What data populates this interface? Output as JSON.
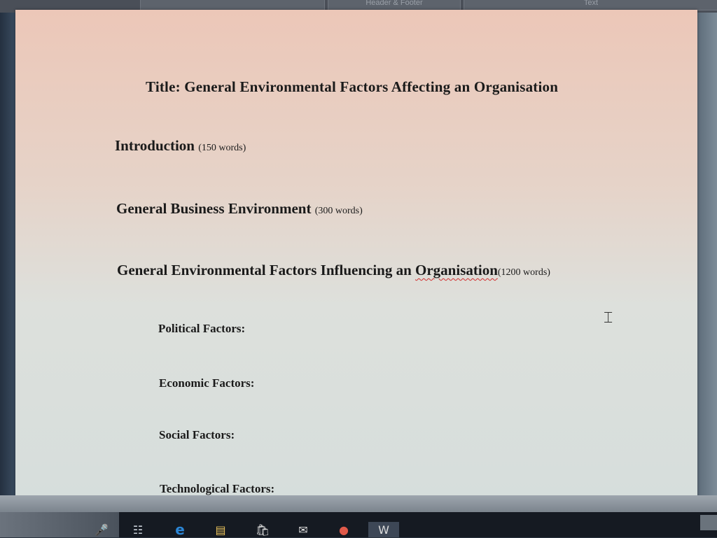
{
  "ribbon": {
    "tabs": [
      "",
      "Header & Footer",
      "Text"
    ]
  },
  "document": {
    "title": "Title:  General Environmental Factors Affecting an Organisation",
    "sections": [
      {
        "heading": "Introduction",
        "word_count": "(150 words)"
      },
      {
        "heading": "General Business Environment",
        "word_count": "(300 words)"
      },
      {
        "heading_prefix": "General Environmental Factors Influencing an ",
        "heading_flagged": "Organisation",
        "word_count": "(1200 words)"
      }
    ],
    "subsections": [
      "Political Factors:",
      "Economic Factors:",
      "Social Factors:",
      "Technological Factors:"
    ]
  },
  "icons": {
    "cursor": "text-cursor-icon",
    "taskbar": [
      "microphone-icon",
      "task-view-icon",
      "edge-icon",
      "file-explorer-icon",
      "store-icon",
      "mail-icon",
      "chrome-icon",
      "word-icon"
    ]
  }
}
